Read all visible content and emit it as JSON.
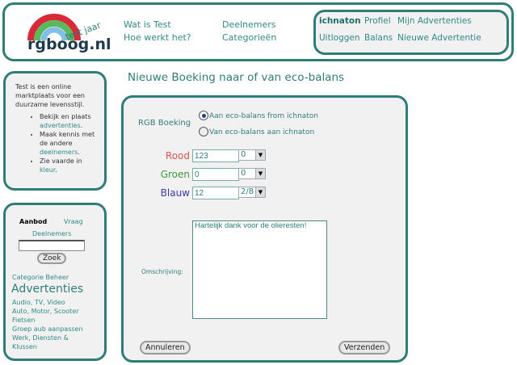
{
  "header": {
    "logo_text": "rgboog.nl",
    "logo_tag": "test jaar",
    "nav": [
      [
        "Wat is Test",
        "Hoe werkt het?"
      ],
      [
        "Deelnemers",
        "Categorieën"
      ]
    ],
    "user": {
      "name": "ichnaton",
      "links": [
        "Profiel",
        "Mijn Advertenties",
        "Uitloggen",
        "Balans",
        "Nieuwe Advertentie"
      ]
    }
  },
  "intro": {
    "text": "Test is een online marktplaats voor een duurzame levensstijl.",
    "items": [
      {
        "pre": "Bekijk en plaats ",
        "link": "advertenties"
      },
      {
        "pre": "Maak kennis met de andere ",
        "link": "deelnemers"
      },
      {
        "pre": "Zie vaarde in ",
        "link": "kleur"
      }
    ]
  },
  "search": {
    "tab_active": "Aanbod",
    "tab_other": "Vraag",
    "tab_members": "Deelnemers",
    "value": "",
    "button": "Zoek",
    "cat_admin": "Categorie Beheer",
    "heading": "Advertenties",
    "categories": [
      "Audio, TV, Video",
      "Auto, Motor, Scooter",
      "Fietsen",
      "Groep aub aanpassen",
      "Werk, Diensten & Klussen"
    ]
  },
  "form": {
    "title": "Nieuwe Boeking naar of van eco-balans",
    "booking_label": "RGB Boeking",
    "radio1": "Aan eco-balans from ichnaton",
    "radio2": "Van eco-balans aan ichnaton",
    "rood_label": "Rood",
    "rood": "123",
    "rood_sel": "0",
    "groen_label": "Groen",
    "groen": "0",
    "groen_sel": "0",
    "blauw_label": "Blauw",
    "blauw": "12",
    "blauw_sel": "2/8",
    "desc_label": "Omschrijving:",
    "desc": "Hartelijk dank voor de olieresten!",
    "cancel": "Annuleren",
    "submit": "Verzenden"
  },
  "colors": {
    "accent": "#2f7d78",
    "rood": "#d9534f",
    "groen": "#3a9a3a",
    "blauw": "#3a3ab0"
  }
}
